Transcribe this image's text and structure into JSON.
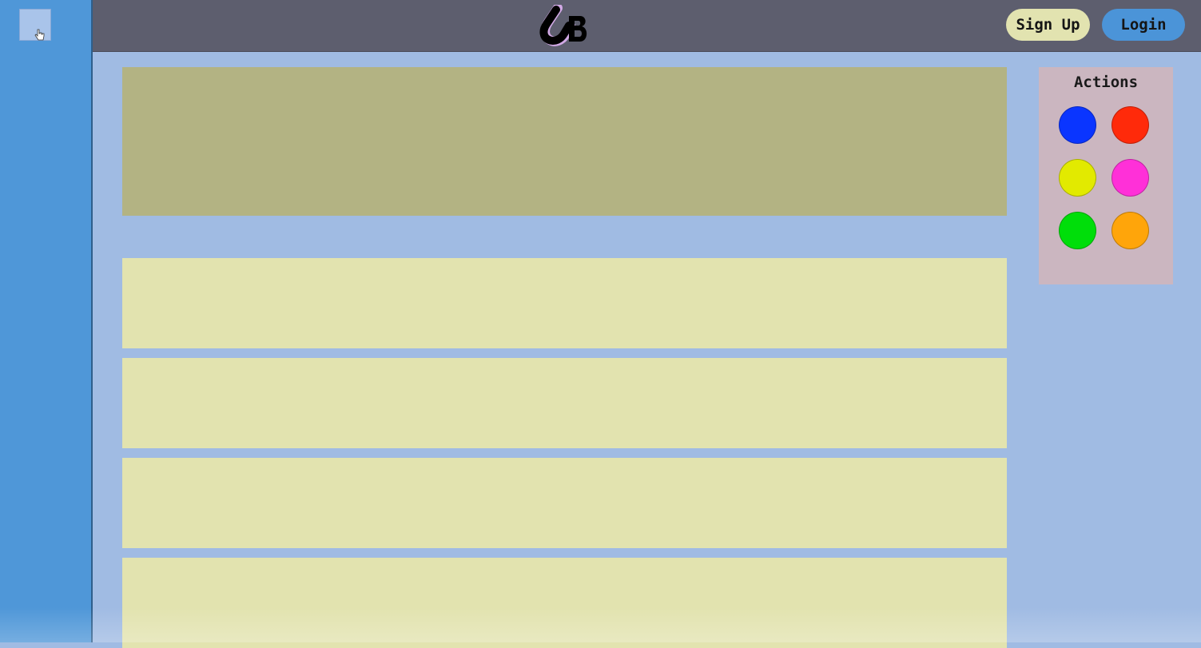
{
  "header": {
    "signup_label": "Sign Up",
    "login_label": "Login"
  },
  "actions": {
    "title": "Actions",
    "swatches": [
      {
        "name": "blue",
        "color": "#0a35ff"
      },
      {
        "name": "red",
        "color": "#ff2a0a"
      },
      {
        "name": "yellow",
        "color": "#e2ea00"
      },
      {
        "name": "magenta",
        "color": "#ff30d8"
      },
      {
        "name": "green",
        "color": "#00de0a"
      },
      {
        "name": "orange",
        "color": "#ffa50a"
      }
    ]
  },
  "icons": {
    "sidebar_toggle": "pointer-hand-icon",
    "logo": "ub-logo-icon"
  },
  "colors": {
    "sidebar": "#4f97d8",
    "header": "#5d5e6e",
    "background": "#a0bbe3",
    "hero": "#b3b383",
    "card": "#e2e3af",
    "actions_panel": "#cbb6c0"
  }
}
